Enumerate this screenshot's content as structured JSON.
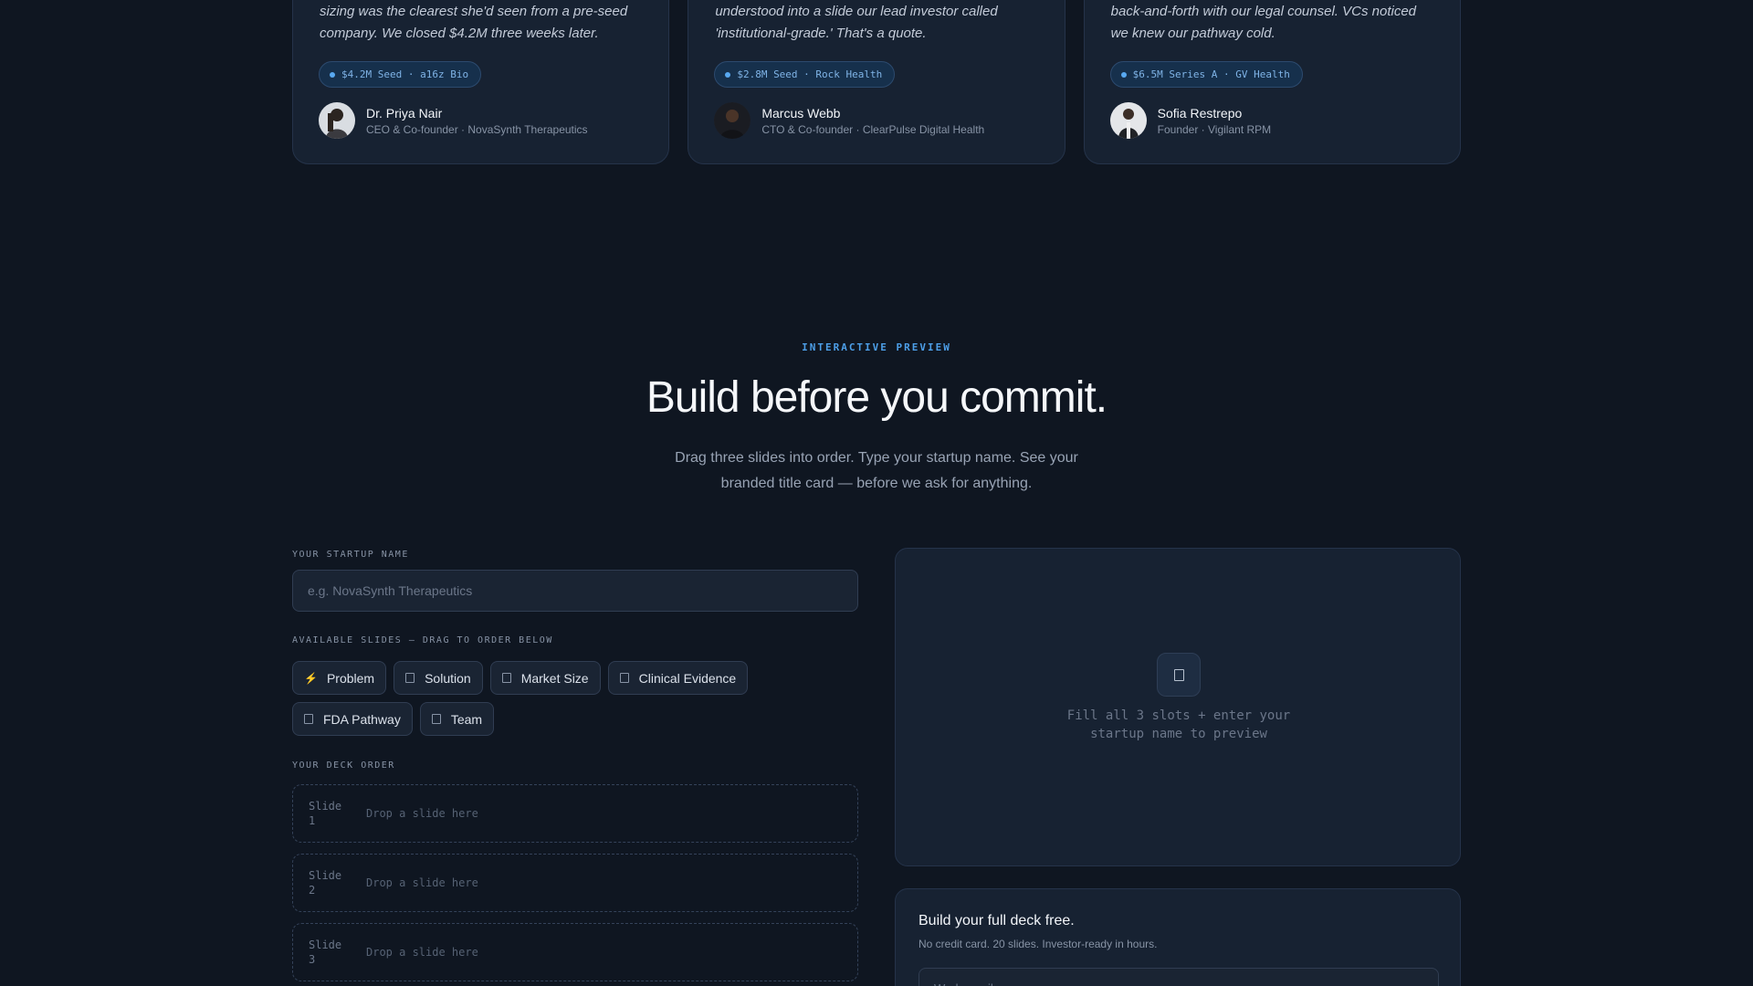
{
  "testimonials": [
    {
      "quote": "sizing was the clearest she'd seen from a pre-seed company. We closed $4.2M three weeks later.",
      "badge": "$4.2M Seed · a16z Bio",
      "name": "Dr. Priya Nair",
      "role": "CEO & Co-founder · NovaSynth Therapeutics"
    },
    {
      "quote": "understood into a slide our lead investor called 'institutional-grade.' That's a quote.",
      "badge": "$2.8M Seed · Rock Health",
      "name": "Marcus Webb",
      "role": "CTO & Co-founder · ClearPulse Digital Health"
    },
    {
      "quote": "back-and-forth with our legal counsel. VCs noticed we knew our pathway cold.",
      "badge": "$6.5M Series A · GV Health",
      "name": "Sofia Restrepo",
      "role": "Founder · Vigilant RPM"
    }
  ],
  "section": {
    "eyebrow": "INTERACTIVE PREVIEW",
    "title": "Build before you commit.",
    "subtitle": "Drag three slides into order. Type your startup name. See your branded title card — before we ask for anything."
  },
  "builder": {
    "name_label": "YOUR STARTUP NAME",
    "name_placeholder": "e.g. NovaSynth Therapeutics",
    "slides_label": "AVAILABLE SLIDES — DRAG TO ORDER BELOW",
    "slides": [
      "Problem",
      "Solution",
      "Market Size",
      "Clinical Evidence",
      "FDA Pathway",
      "Team"
    ],
    "order_label": "YOUR DECK ORDER",
    "slots": [
      {
        "label": "Slide 1",
        "drop": "Drop a slide here"
      },
      {
        "label": "Slide 2",
        "drop": "Drop a slide here"
      },
      {
        "label": "Slide 3",
        "drop": "Drop a slide here"
      }
    ]
  },
  "preview": {
    "message": "Fill all 3 slots + enter your startup name to preview"
  },
  "cta": {
    "title": "Build your full deck free.",
    "subtitle": "No credit card. 20 slides. Investor-ready in hours.",
    "email_placeholder": "Work email"
  },
  "icons": {
    "problem": "lightning-bolt-icon",
    "slide": "document-icon",
    "preview": "document-icon"
  },
  "colors": {
    "background": "#0f1621",
    "card": "#172232",
    "accent": "#4d9fe8"
  }
}
